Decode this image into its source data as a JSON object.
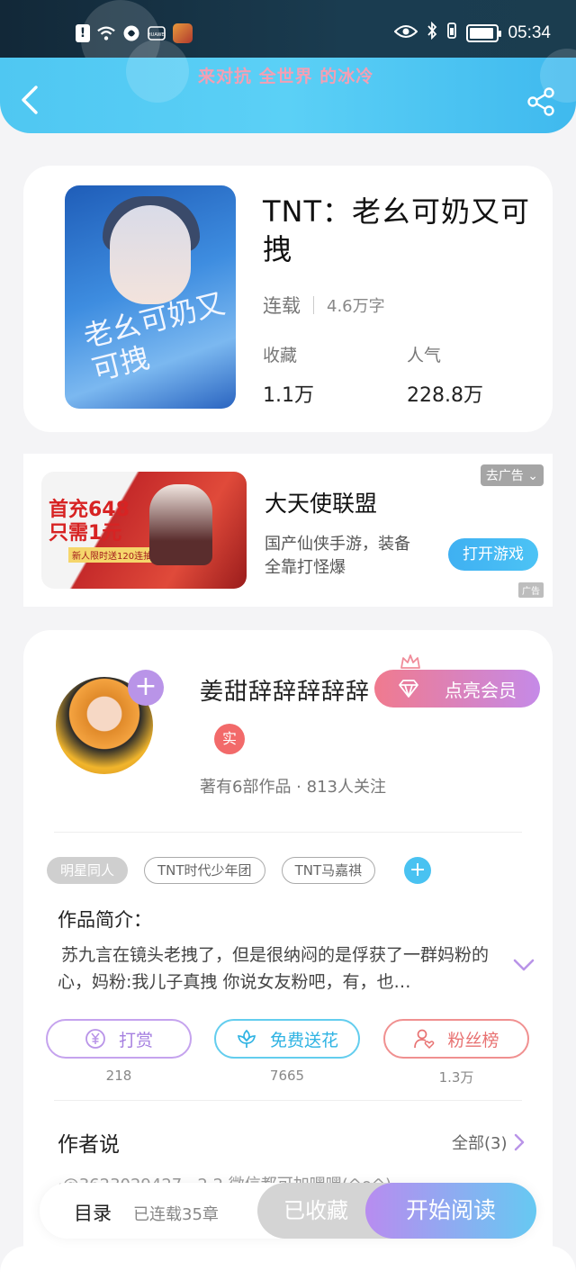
{
  "status_bar": {
    "time": "05:34",
    "left_icons": [
      "alert-icon",
      "wifi-icon",
      "sync-icon",
      "huawei-app-icon",
      "game-app-icon"
    ],
    "right_icons": [
      "eye-icon",
      "bluetooth-icon",
      "vibrate-icon",
      "battery-icon"
    ]
  },
  "nav": {
    "marquee": "来对抗 全世界 的冰冷",
    "back_icon": "chevron-left-icon",
    "share_icon": "share-icon"
  },
  "book": {
    "title": "TNT：老幺可奶又可拽",
    "status": "连载",
    "words": "4.6万字",
    "fav_label": "收藏",
    "fav_value": "1.1万",
    "pop_label": "人气",
    "pop_value": "228.8万",
    "cover_script": "老幺可奶又可拽"
  },
  "ad": {
    "dislike_label": "去广告",
    "title": "大天使联盟",
    "description": "国产仙侠手游，装备全靠打怪爆",
    "cta": "打开游戏",
    "badge": "广告",
    "promo_line1": "首充648",
    "promo_line2": "只需1元",
    "promo_sub": "新人限时送120连抽"
  },
  "author": {
    "name": "姜甜辞辞辞辞辞",
    "vip_label": "点亮会员",
    "real_badge": "实",
    "stats": "著有6部作品 · 813人关注",
    "follow_plus": "+"
  },
  "tags": [
    "明星同人",
    "TNT时代少年团",
    "TNT马嘉祺"
  ],
  "tag_add": "+",
  "intro": {
    "title": "作品简介：",
    "text": "苏九言在镜头老拽了，但是很纳闷的是俘获了一群妈粉的心，妈粉:我儿子真拽 你说女友粉吧，有，也…"
  },
  "actions": [
    {
      "label": "打赏",
      "count": "218",
      "icon": "yen-coin-icon"
    },
    {
      "label": "免费送花",
      "count": "7665",
      "icon": "flower-icon"
    },
    {
      "label": "粉丝榜",
      "count": "1.3万",
      "icon": "user-heart-icon"
    }
  ],
  "author_says": {
    "title": "作者说",
    "all_label": "全部(3)",
    "preview": "·@3623029427 · 2 2 微信都可加嘿嘿(^o^)"
  },
  "bottom": {
    "toc_label": "目录",
    "chapters": "已连载35章",
    "collected": "已收藏",
    "read": "开始阅读"
  },
  "colors": {
    "nav_gradient": "#4fc7f2",
    "accent_blue": "#49c2f1",
    "accent_purple": "#b994e8",
    "accent_red": "#f26a6a"
  }
}
